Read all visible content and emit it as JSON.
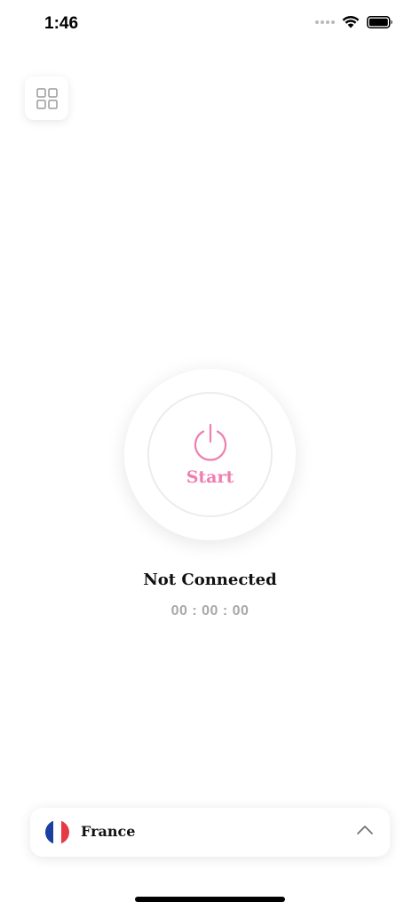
{
  "status_bar": {
    "time": "1:46"
  },
  "menu": {
    "icon": "grid-icon"
  },
  "power_button": {
    "label": "Start",
    "icon": "power-icon",
    "accent_color": "#ee7fb0"
  },
  "connection": {
    "status": "Not Connected",
    "timer": "00 : 00 : 00"
  },
  "server": {
    "country": "France",
    "flag_colors": [
      "#1a3fa0",
      "#ffffff",
      "#e63946"
    ],
    "chevron_icon": "chevron-up-icon"
  }
}
